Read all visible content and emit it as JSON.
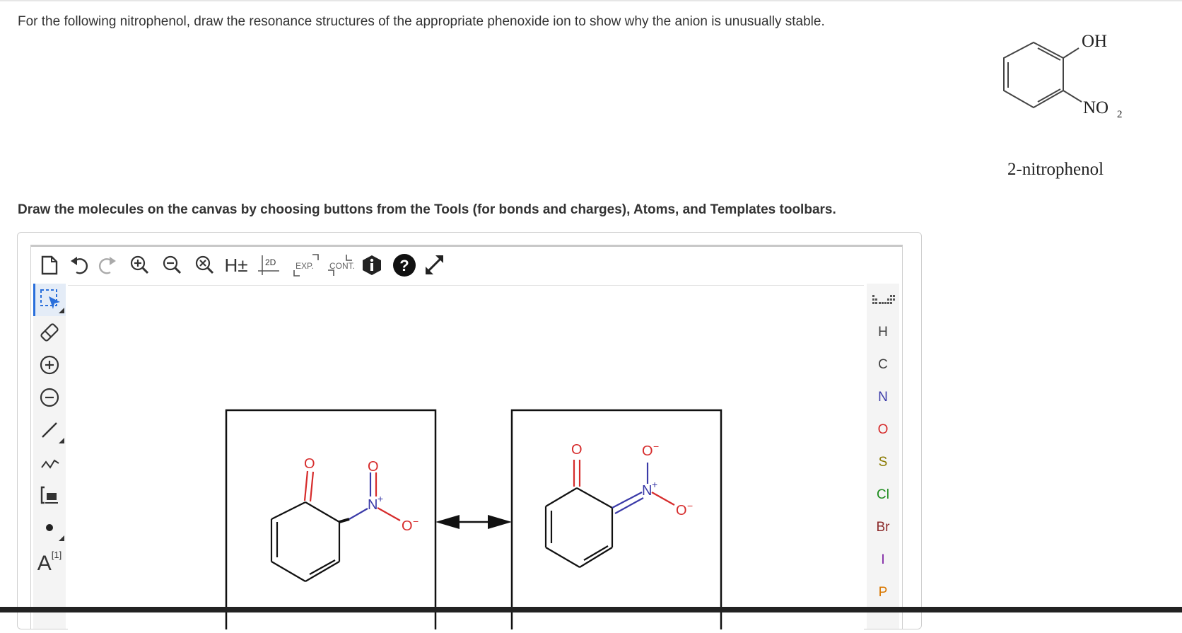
{
  "question": "For the following nitrophenol, draw the resonance structures of the appropriate phenoxide ion to show why the anion is unusually stable.",
  "reference": {
    "oh_label": "OH",
    "no2_label": "NO",
    "no2_sub": "2",
    "caption": "2-nitrophenol"
  },
  "instruction": "Draw the molecules on the canvas by choosing buttons from the Tools (for bonds and charges), Atoms, and Templates toolbars.",
  "top_toolbar": {
    "h_label": "H±",
    "clean2d_label": "2D",
    "expand_label": "EXP.",
    "contract_label": "CONT."
  },
  "left_toolbar": {
    "text_label": "A",
    "text_sup": "[1]"
  },
  "atoms": [
    {
      "symbol": "H",
      "color": "#404040"
    },
    {
      "symbol": "C",
      "color": "#404040"
    },
    {
      "symbol": "N",
      "color": "#3a3aa8"
    },
    {
      "symbol": "O",
      "color": "#d62b2b"
    },
    {
      "symbol": "S",
      "color": "#8a7a00"
    },
    {
      "symbol": "Cl",
      "color": "#1e8c1e"
    },
    {
      "symbol": "Br",
      "color": "#8b2a2a"
    },
    {
      "symbol": "I",
      "color": "#7b1fa2"
    },
    {
      "symbol": "P",
      "color": "#d97700"
    }
  ],
  "canvas": {
    "structure1": {
      "o_label": "O",
      "n_label": "N",
      "n_charge": "+",
      "o_top_label": "O",
      "o_minus_label": "O",
      "o_minus_charge": "−"
    },
    "structure2": {
      "o_label": "O",
      "n_label": "N",
      "n_charge": "+",
      "o_top_label": "O",
      "o_top_charge": "−",
      "o_minus_label": "O",
      "o_minus_charge": "−"
    }
  },
  "colors": {
    "nitrogen": "#3a3aa8",
    "oxygen": "#d62b2b",
    "accent": "#2a6fdb"
  }
}
